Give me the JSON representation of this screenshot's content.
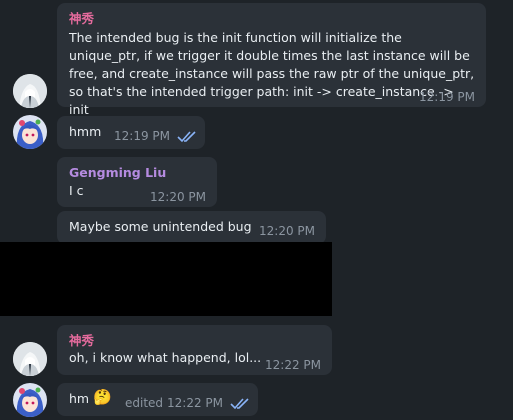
{
  "messages": [
    {
      "sender": "神秀",
      "text": "The intended bug is the init function will initialize the unique_ptr, if we trigger it double times the last instance will be free, and create_instance will pass the raw ptr of the unique_ptr, so that's the intended trigger path: init -> create_instance -> init",
      "time": "12:19 PM"
    },
    {
      "text": "hmm",
      "time": "12:19 PM",
      "status": "read"
    },
    {
      "sender": "Gengming Liu",
      "text": "I c",
      "time": "12:20 PM"
    },
    {
      "text": "Maybe some unintended bug",
      "time": "12:20 PM"
    },
    {
      "sender": "神秀",
      "text": "oh, i know what happend, lol...",
      "time": "12:22 PM"
    },
    {
      "text": "hm",
      "emoji": "🤔",
      "edited_label": "edited",
      "time": "12:22 PM",
      "status": "read"
    }
  ],
  "colors": {
    "background": "#1e2328",
    "bubble": "#2b3138",
    "name_pink": "#e56b9d",
    "name_purple": "#b58be0",
    "time": "#8b95a0",
    "check": "#8ab4f8"
  },
  "icons": {
    "avatar_white": "white-hair-avatar-icon",
    "avatar_anime": "blue-hair-avatar-icon",
    "read_status": "double-check-icon"
  }
}
